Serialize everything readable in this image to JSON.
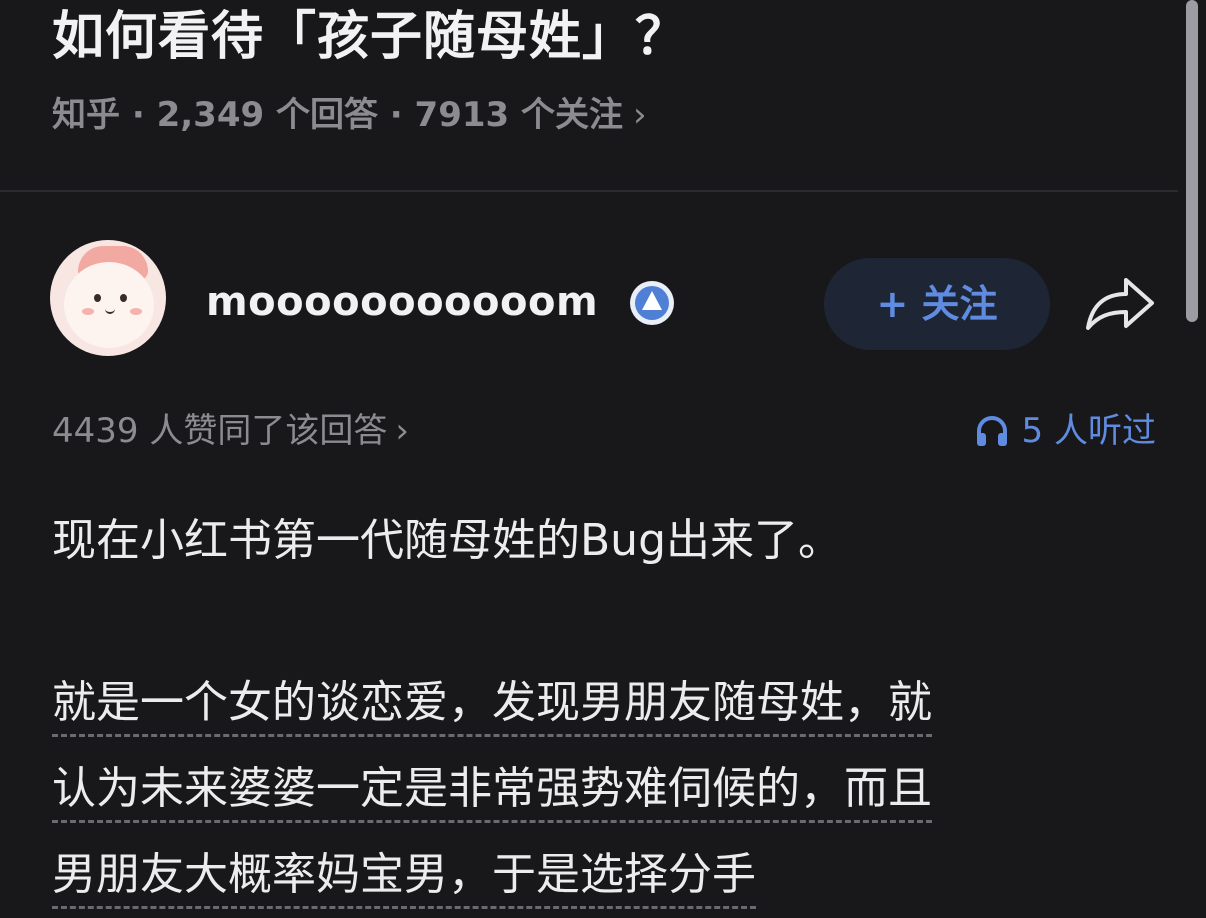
{
  "question": {
    "title": "如何看待「孩子随母姓」？",
    "meta": "知乎 · 2,349 个回答 · 7913 个关注",
    "meta_chevron": "›"
  },
  "answer": {
    "author_name": "mooooooooooom",
    "follow_label": "+ 关注",
    "likes_text": "4439 人赞同了该回答",
    "likes_chevron": "›",
    "listened_text": "5 人听过",
    "paragraph_1": "现在小红书第一代随母姓的Bug出来了。",
    "paragraph_2_lines": [
      "就是一个女的谈恋爱，发现男朋友随母姓，就",
      "认为未来婆婆一定是非常强势难伺候的，而且",
      "男朋友大概率妈宝男，于是选择分手"
    ]
  },
  "icons": {
    "verified_badge": "verified-badge-icon",
    "share": "share-icon",
    "headphones": "headphones-icon"
  },
  "colors": {
    "background": "#18181b",
    "accent_blue": "#5f8ce0",
    "muted_text": "#8b8b90",
    "follow_button_bg": "#1e2535"
  }
}
